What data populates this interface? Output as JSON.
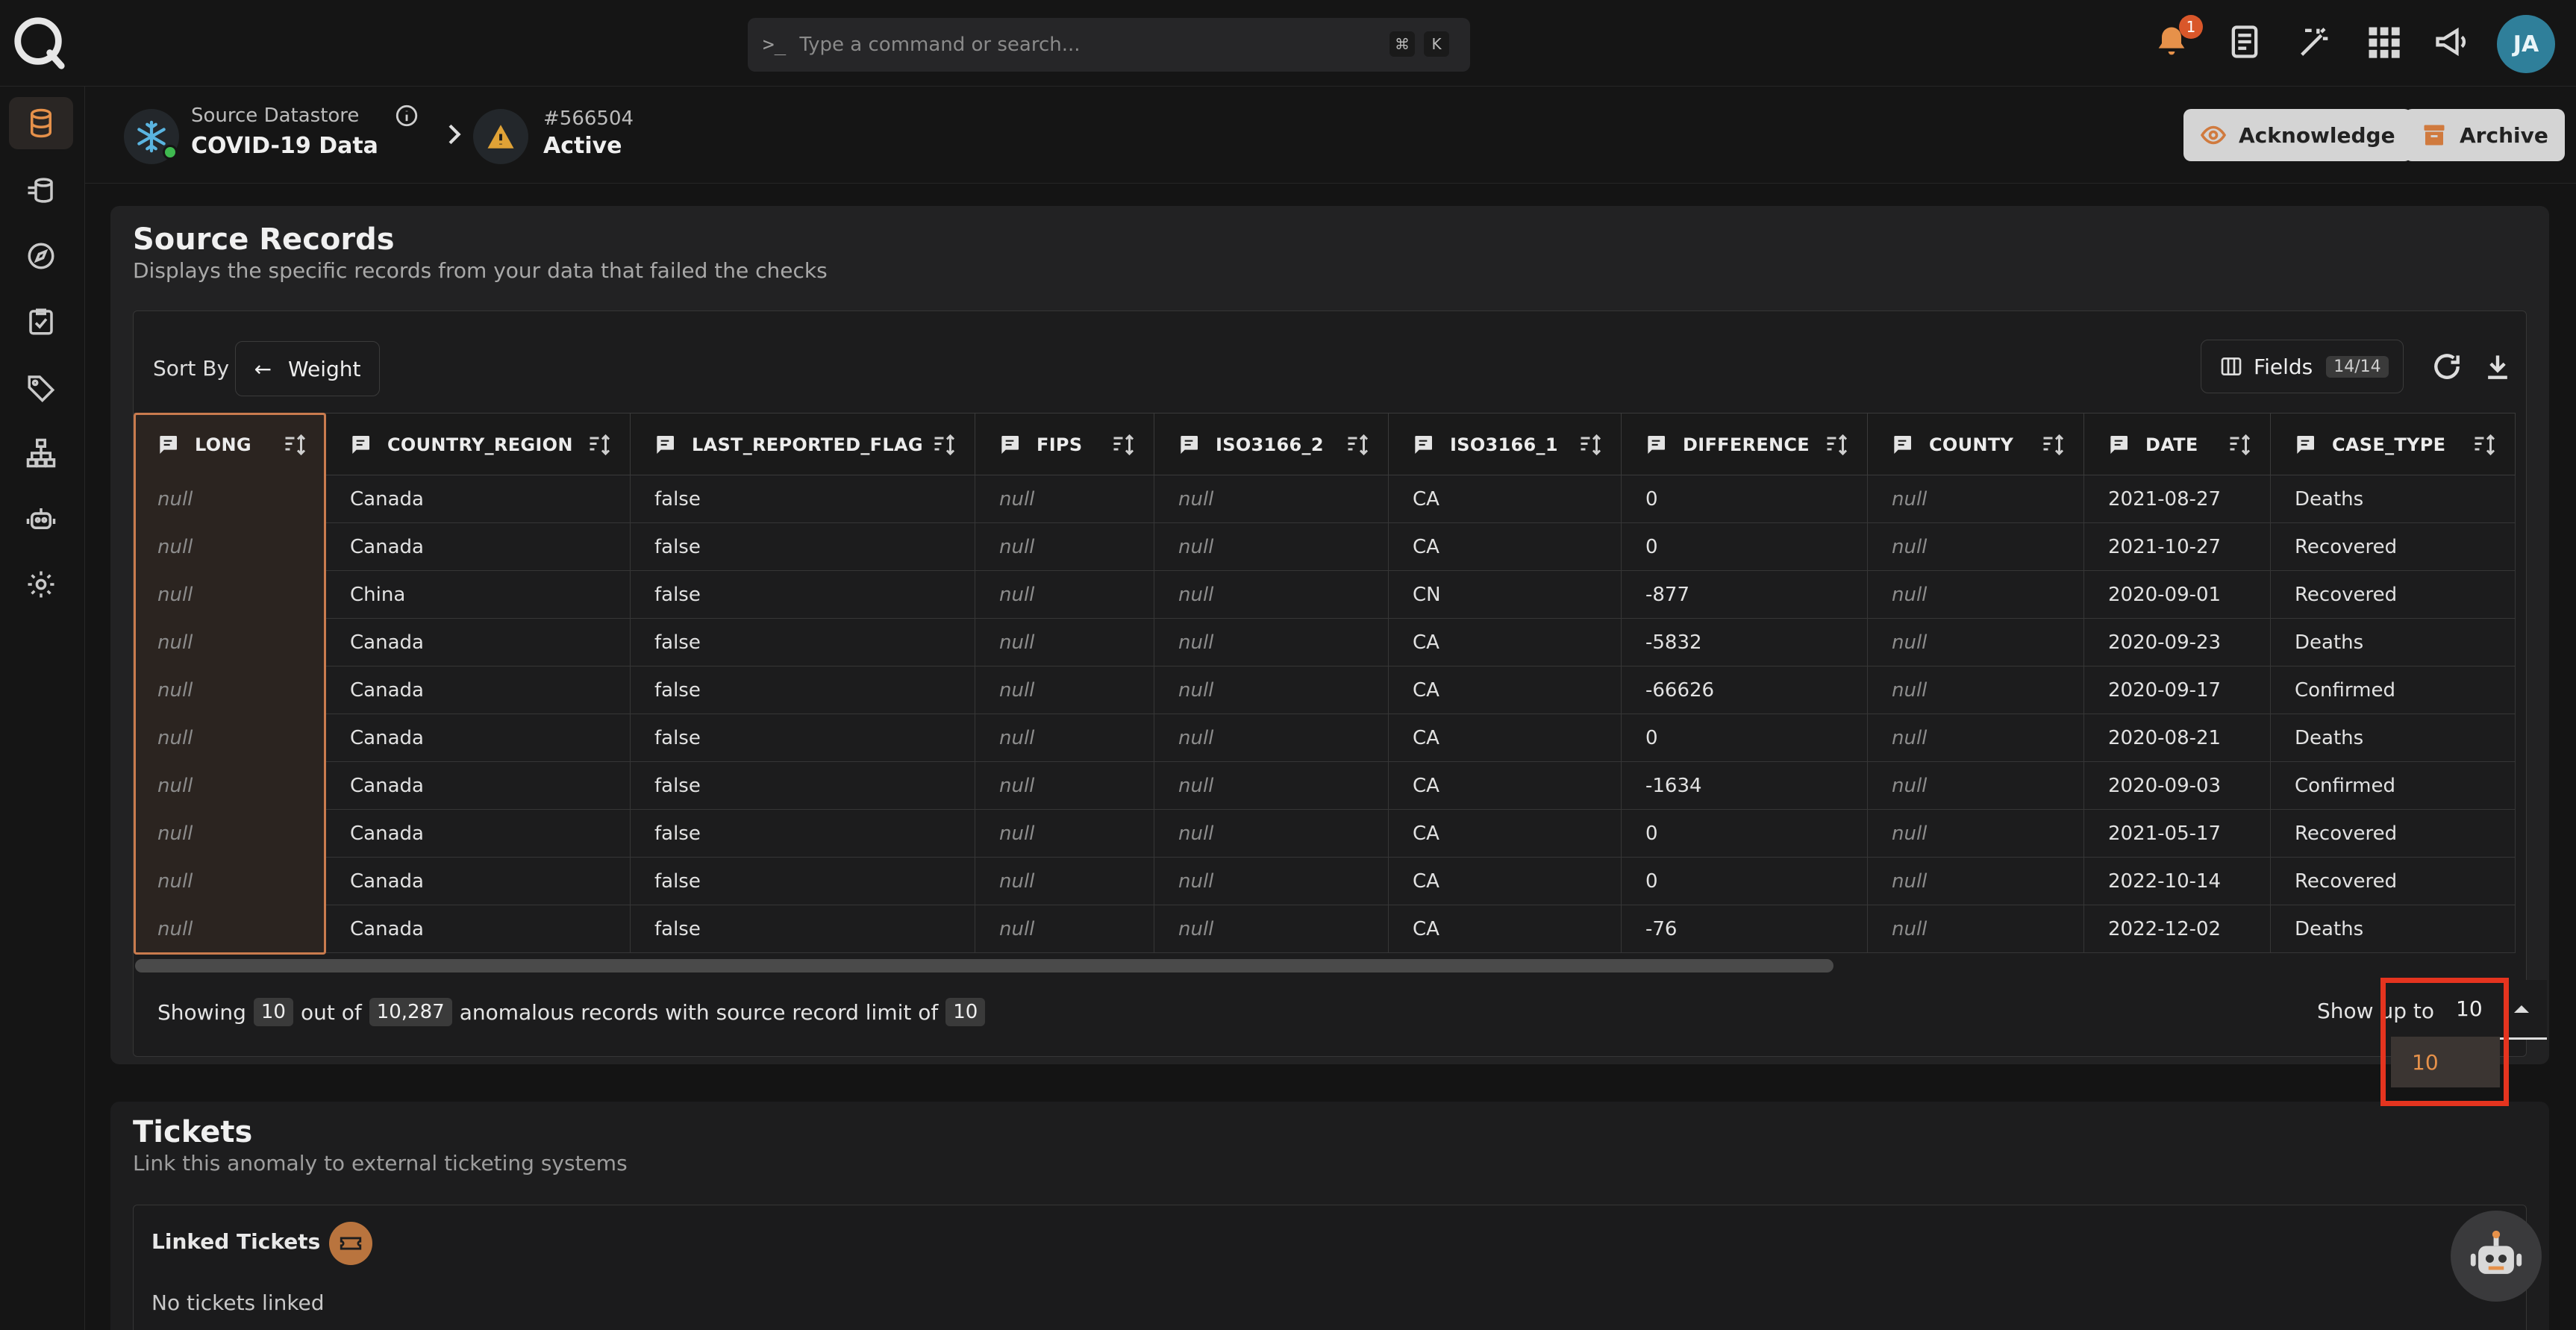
{
  "colors": {
    "accent": "#e6914a",
    "highlight_border": "#e5341f",
    "background": "#1b1b1c"
  },
  "topbar": {
    "search": {
      "placeholder": "Type a command or search...",
      "shortcut_keys": [
        "⌘",
        "K"
      ]
    },
    "notification_count": "1",
    "icons": [
      "bell-icon",
      "document-icon",
      "magic-wand-icon",
      "apps-grid-icon",
      "megaphone-icon"
    ],
    "user_initials": "JA"
  },
  "sidebar": {
    "items": [
      "database-icon",
      "datastore-icon",
      "compass-icon",
      "checklist-icon",
      "tag-icon",
      "hierarchy-icon",
      "robot-icon",
      "settings-icon"
    ],
    "active": 0
  },
  "header": {
    "datastore_label": "Source Datastore",
    "datastore_name": "COVID-19 Data",
    "anomaly_id": "#566504",
    "anomaly_status": "Active",
    "acknowledge_label": "Acknowledge",
    "archive_label": "Archive"
  },
  "source_records": {
    "title": "Source Records",
    "subtitle": "Displays the specific records from your data that failed the checks",
    "sort_by_label": "Sort By",
    "sort_value": "Weight",
    "fields_label": "Fields",
    "fields_count": "14/14",
    "columns": [
      "LONG",
      "COUNTRY_REGION",
      "LAST_REPORTED_FLAG",
      "FIPS",
      "ISO3166_2",
      "ISO3166_1",
      "DIFFERENCE",
      "COUNTY",
      "DATE",
      "CASE_TYPE"
    ],
    "rows": [
      [
        "null",
        "Canada",
        "false",
        "null",
        "null",
        "CA",
        "0",
        "null",
        "2021-08-27",
        "Deaths"
      ],
      [
        "null",
        "Canada",
        "false",
        "null",
        "null",
        "CA",
        "0",
        "null",
        "2021-10-27",
        "Recovered"
      ],
      [
        "null",
        "China",
        "false",
        "null",
        "null",
        "CN",
        "-877",
        "null",
        "2020-09-01",
        "Recovered"
      ],
      [
        "null",
        "Canada",
        "false",
        "null",
        "null",
        "CA",
        "-5832",
        "null",
        "2020-09-23",
        "Deaths"
      ],
      [
        "null",
        "Canada",
        "false",
        "null",
        "null",
        "CA",
        "-66626",
        "null",
        "2020-09-17",
        "Confirmed"
      ],
      [
        "null",
        "Canada",
        "false",
        "null",
        "null",
        "CA",
        "0",
        "null",
        "2020-08-21",
        "Deaths"
      ],
      [
        "null",
        "Canada",
        "false",
        "null",
        "null",
        "CA",
        "-1634",
        "null",
        "2020-09-03",
        "Confirmed"
      ],
      [
        "null",
        "Canada",
        "false",
        "null",
        "null",
        "CA",
        "0",
        "null",
        "2021-05-17",
        "Recovered"
      ],
      [
        "null",
        "Canada",
        "false",
        "null",
        "null",
        "CA",
        "0",
        "null",
        "2022-10-14",
        "Recovered"
      ],
      [
        "null",
        "Canada",
        "false",
        "null",
        "null",
        "CA",
        "-76",
        "null",
        "2022-12-02",
        "Deaths"
      ]
    ],
    "footer": {
      "showing_prefix": "Showing",
      "shown": "10",
      "out_of": "out of",
      "total": "10,287",
      "middle": "anomalous records with source record limit of",
      "limit": "10",
      "show_up_to_label": "Show up to",
      "selected": "10",
      "options": [
        "10"
      ]
    }
  },
  "tickets": {
    "title": "Tickets",
    "subtitle": "Link this anomaly to external ticketing systems",
    "linked_label": "Linked Tickets",
    "empty_text": "No tickets linked"
  }
}
